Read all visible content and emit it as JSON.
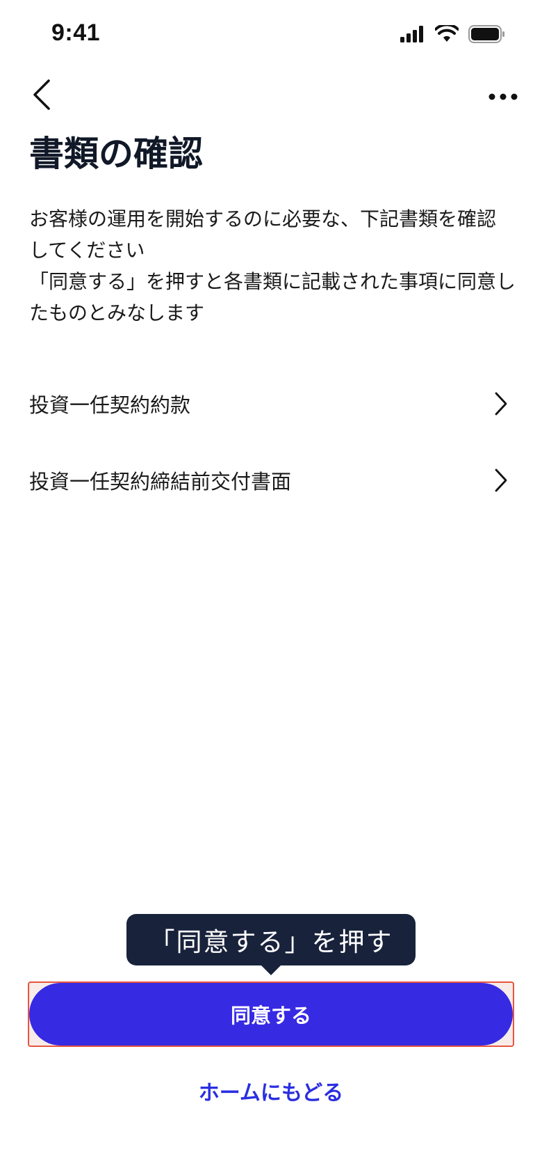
{
  "status_bar": {
    "time": "9:41",
    "icons": [
      "signal-icon",
      "wifi-icon",
      "battery-icon"
    ]
  },
  "nav": {
    "back_icon": "chevron-left-icon",
    "more_icon": "more-horizontal-icon"
  },
  "page": {
    "title": "書類の確認",
    "description_lines": [
      "お客様の運用を開始するのに必要な、下記書類を確認してください",
      "「同意する」を押すと各書類に記載された事項に同意したものとみなします"
    ]
  },
  "documents": [
    {
      "label": "投資一任契約約款"
    },
    {
      "label": "投資一任契約締結前交付書面"
    }
  ],
  "tooltip": {
    "text": "「同意する」を押す"
  },
  "actions": {
    "agree_label": "同意する",
    "home_label": "ホームにもどる"
  },
  "colors": {
    "primary": "#372ae3",
    "link": "#2a2ee0",
    "tooltip_bg": "#18223b",
    "highlight_border": "#e8543f"
  }
}
